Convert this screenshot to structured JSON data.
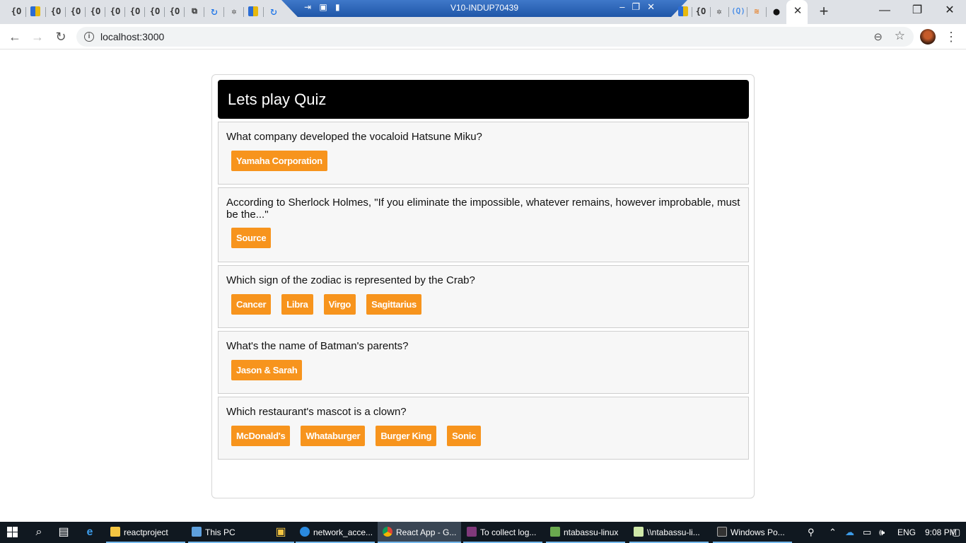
{
  "browser": {
    "tab_icons": [
      "{O",
      "{O",
      "{O",
      "{O",
      "{O",
      "{O",
      "{O",
      "{O"
    ],
    "remote_session_title": "V10-INDUP70439",
    "tab_close": "✕",
    "new_tab": "+",
    "minimize": "—",
    "maximize": "❐",
    "close": "✕",
    "url": "localhost:3000"
  },
  "quiz": {
    "title": "Lets play Quiz",
    "questions": [
      {
        "text": "What company developed the vocaloid Hatsune Miku?",
        "answers": [
          "Yamaha Corporation"
        ]
      },
      {
        "text": "According to Sherlock Holmes, \"If you eliminate the impossible, whatever remains, however improbable, must be the...\"",
        "answers": [
          "Source"
        ]
      },
      {
        "text": "Which sign of the zodiac is represented by the Crab?",
        "answers": [
          "Cancer",
          "Libra",
          "Virgo",
          "Sagittarius"
        ]
      },
      {
        "text": "What's the name of Batman's parents?",
        "answers": [
          "Jason & Sarah"
        ]
      },
      {
        "text": "Which restaurant's mascot is a clown?",
        "answers": [
          "McDonald's",
          "Whataburger",
          "Burger King",
          "Sonic"
        ]
      }
    ]
  },
  "colors": {
    "answer_button": "#f7941d",
    "header_bg": "#000000"
  },
  "taskbar": {
    "items": [
      {
        "label": "reactproject",
        "icon": "folder-icon"
      },
      {
        "label": "This PC",
        "icon": "computer-icon"
      },
      {
        "label": "network_acce...",
        "icon": "ie-icon"
      },
      {
        "label": "React App - G...",
        "icon": "chrome-icon"
      },
      {
        "label": "To collect log...",
        "icon": "onenote-icon"
      },
      {
        "label": "ntabassu-linux",
        "icon": "rdp-icon"
      },
      {
        "label": "\\\\ntabassu-li...",
        "icon": "notepad-icon"
      },
      {
        "label": "Windows Po...",
        "icon": "powershell-icon"
      }
    ],
    "language": "ENG",
    "time": "9:08 PM"
  }
}
